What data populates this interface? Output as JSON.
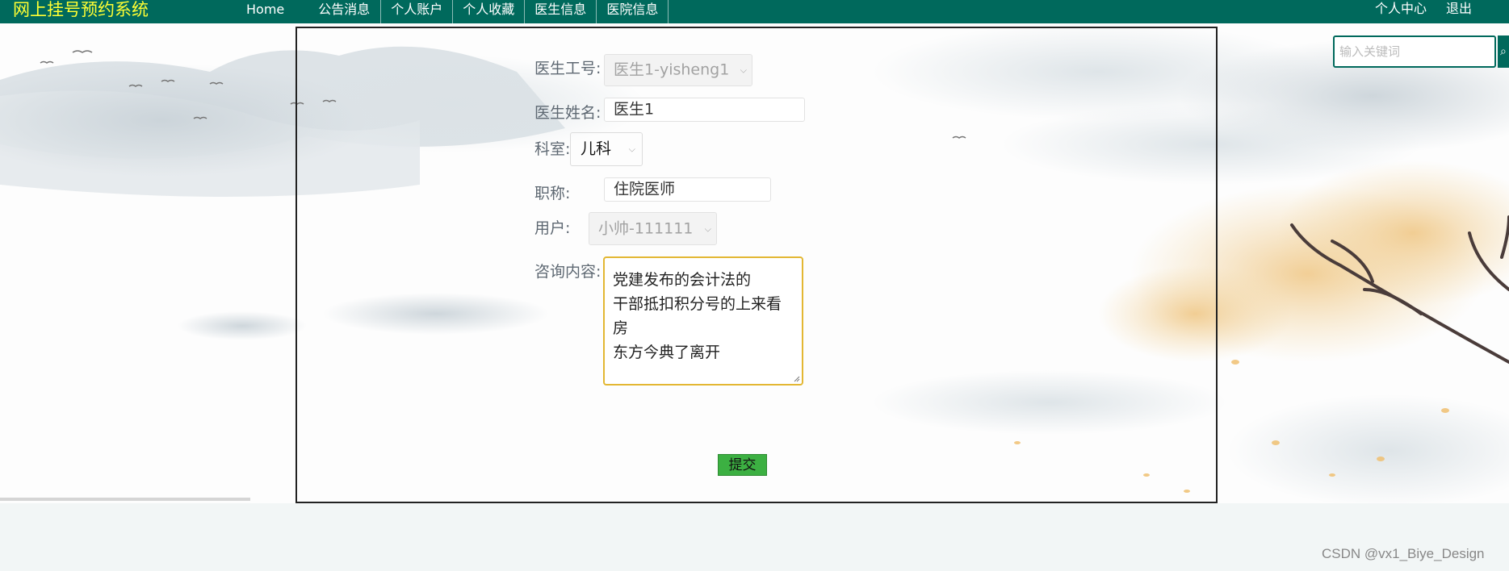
{
  "brand": "网上挂号预约系统",
  "nav": {
    "items": [
      "Home",
      "公告消息",
      "个人账户",
      "个人收藏",
      "医生信息",
      "医院信息"
    ],
    "right": [
      "个人中心",
      "退出"
    ]
  },
  "search": {
    "placeholder": "输入关键词"
  },
  "form": {
    "doctor_id": {
      "label": "医生工号:",
      "value": "医生1-yisheng1"
    },
    "doctor_name": {
      "label": "医生姓名:",
      "value": "医生1"
    },
    "department": {
      "label": "科室:",
      "value": "儿科"
    },
    "title": {
      "label": "职称:",
      "value": "住院医师"
    },
    "user": {
      "label": "用户:",
      "value": "小帅-111111"
    },
    "content": {
      "label": "咨询内容:",
      "lines": [
        "党建发布的会计法的",
        "干部抵扣积分号的上来看",
        "房",
        "东方今典了离开"
      ]
    },
    "submit_label": "提交"
  },
  "watermark": "CSDN @vx1_Biye_Design",
  "colors": {
    "nav_bg": "#00695c",
    "brand": "#ffff33",
    "submit_bg": "#3cb042",
    "focus_border": "#e3b733"
  },
  "icons": [
    "chevron-down-icon",
    "search-icon",
    "resize-grip-icon"
  ]
}
